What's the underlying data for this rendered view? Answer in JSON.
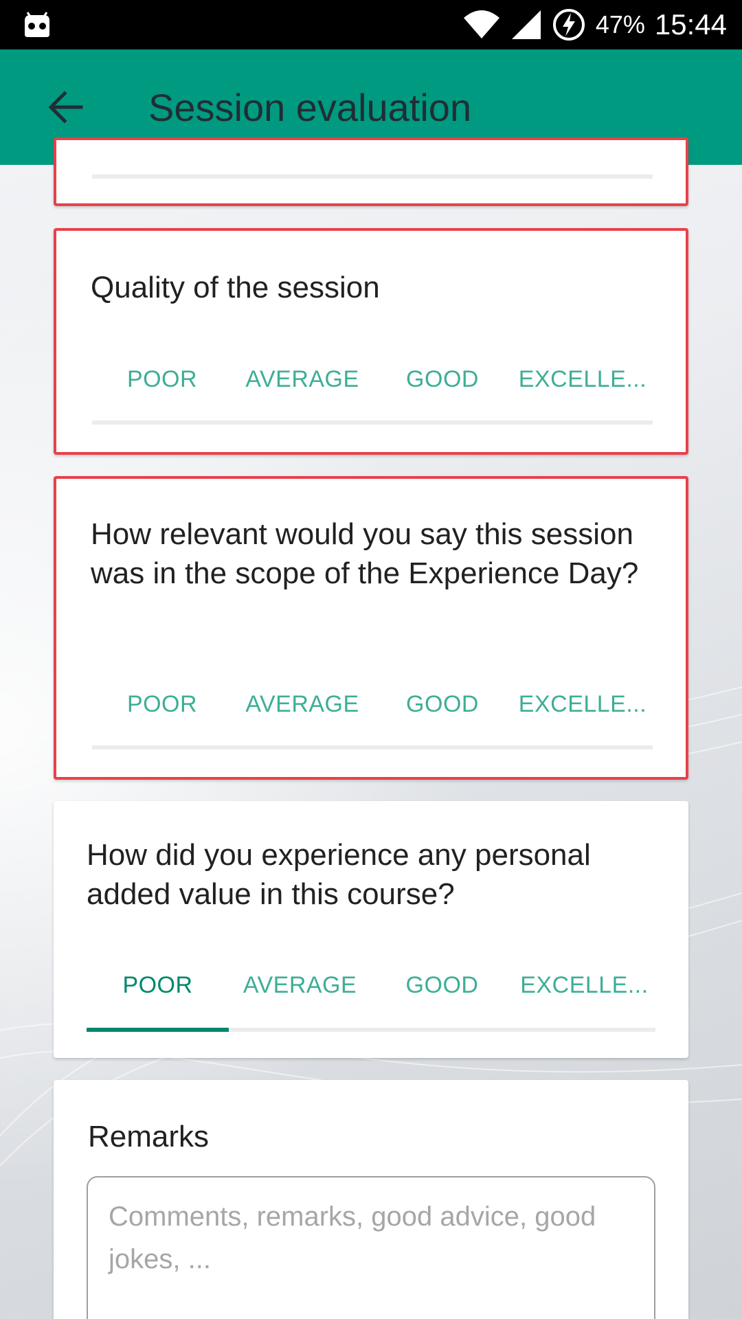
{
  "status_bar": {
    "battery": "47%",
    "time": "15:44",
    "icons": [
      "android-robot-icon",
      "wifi-icon",
      "cellular-signal-icon",
      "battery-charging-icon"
    ]
  },
  "app_bar": {
    "title": "Session evaluation",
    "back_icon": "arrow-left-icon",
    "background": "#009a80"
  },
  "rating_options": [
    "POOR",
    "AVERAGE",
    "GOOD",
    "EXCELLE..."
  ],
  "questions": [
    {
      "text": "",
      "invalid": true,
      "selected": null
    },
    {
      "text": "Quality of the session",
      "invalid": true,
      "selected": null
    },
    {
      "text": "How relevant would you say this session was in the scope of the Experience Day?",
      "invalid": true,
      "selected": null
    },
    {
      "text": "How did you experience any personal added value in this course?",
      "invalid": false,
      "selected": "POOR"
    }
  ],
  "remarks": {
    "label": "Remarks",
    "value": "",
    "placeholder": "Comments, remarks, good advice, good jokes, ..."
  },
  "colors": {
    "accent": "#00876e",
    "tab_text": "#3dae96",
    "error_border": "#e8414a"
  }
}
